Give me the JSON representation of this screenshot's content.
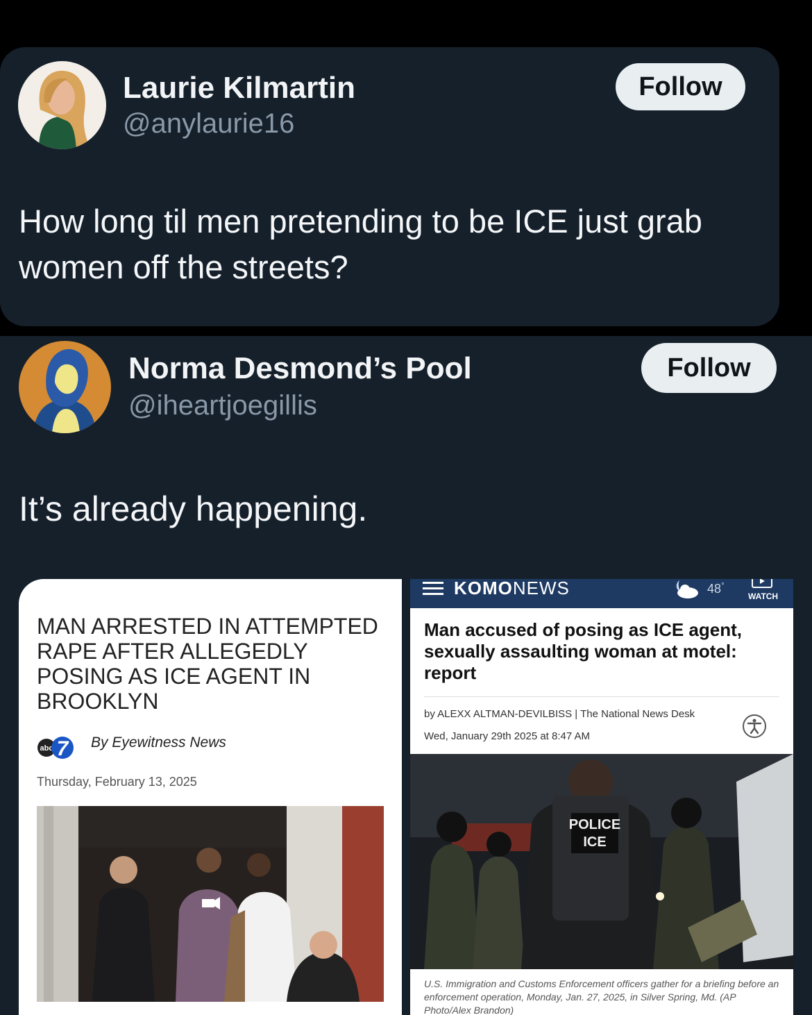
{
  "tweet1": {
    "author_name": "Laurie Kilmartin",
    "author_handle": "@anylaurie16",
    "follow_label": "Follow",
    "text": "How long til men pretending to be ICE just grab women off the streets?"
  },
  "tweet2": {
    "author_name": "Norma Desmond’s Pool",
    "author_handle": "@iheartjoegillis",
    "follow_label": "Follow",
    "text": "It’s already happening."
  },
  "card_abc": {
    "headline": "MAN ARRESTED IN ATTEMPTED RAPE AFTER ALLEGEDLY POSING AS ICE AGENT IN BROOKLYN",
    "logo_text": "abc",
    "byline": "By Eyewitness News",
    "date": "Thursday, February 13, 2025"
  },
  "card_komo": {
    "logo_bold": "KOMO",
    "logo_light": "NEWS",
    "temperature": "48",
    "temperature_unit": "°",
    "watch_label": "WATCH",
    "headline": "Man accused of posing as ICE agent, sexually assaulting woman at motel: report",
    "byline": "by ALEXX ALTMAN-DEVILBISS | The National News Desk",
    "date": "Wed, January 29th 2025 at 8:47 AM",
    "vest_label_line1": "POLICE",
    "vest_label_line2": "ICE",
    "caption": "U.S. Immigration and Customs Enforcement officers gather for a briefing before an enforcement operation, Monday, Jan. 27, 2025, in Silver Spring, Md. (AP Photo/Alex Brandon)"
  },
  "colors": {
    "tweet_bg": "#15202b",
    "komo_blue": "#1e3a63",
    "follow_bg": "#e9eef1"
  }
}
